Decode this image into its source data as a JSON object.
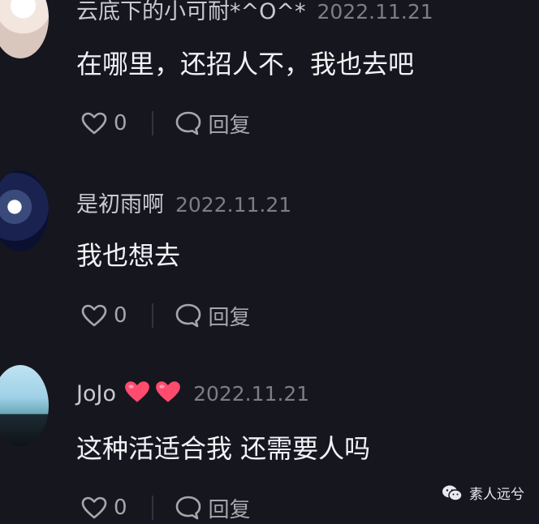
{
  "comments": [
    {
      "username": "云底下的小可耐*^O^*",
      "date": "2022.11.21",
      "text": "在哪里，还招人不，我也去吧",
      "like_count": "0",
      "reply_label": "回复"
    },
    {
      "username": "是初雨啊",
      "date": "2022.11.21",
      "text": "我也想去",
      "like_count": "0",
      "reply_label": "回复"
    },
    {
      "username": "JoJo",
      "date": "2022.11.21",
      "text": "这种活适合我 还需要人吗",
      "like_count": "0",
      "reply_label": "回复"
    }
  ],
  "watermark": {
    "text": "素人远兮"
  },
  "colors": {
    "background": "#16161f",
    "heart_emoji": "#ff4b6e"
  }
}
